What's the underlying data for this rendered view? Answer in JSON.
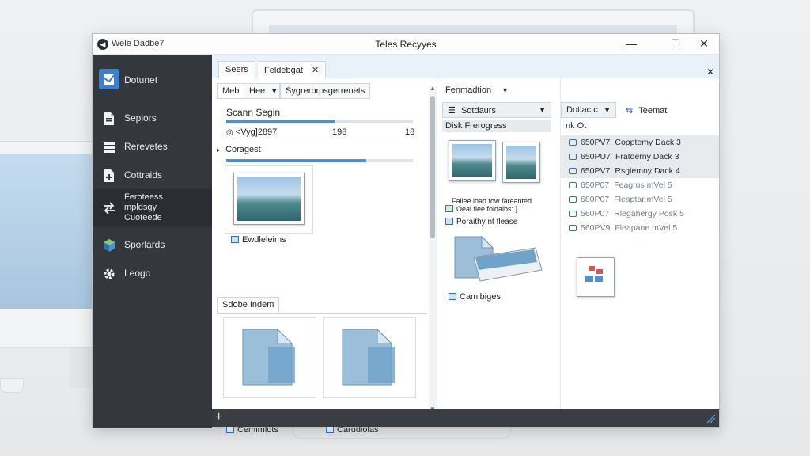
{
  "window": {
    "app_name": "Wele Dadbe7",
    "title": "Teles Recyyes",
    "controls": {
      "minimize": "—",
      "maximize": "☐",
      "close": "✕"
    }
  },
  "sidebar": {
    "items": [
      {
        "label": "Dotunet",
        "icon": "app-icon"
      },
      {
        "label": "Seplors",
        "icon": "document-icon"
      },
      {
        "label": "Rerevetes",
        "icon": "stack-icon"
      },
      {
        "label": "Cottraids",
        "icon": "doc-plus-icon"
      },
      {
        "label": "Feroteess\nmpldsgy\nCuoteede",
        "icon": "transfer-icon"
      },
      {
        "label": "Sporlards",
        "icon": "cube-icon"
      },
      {
        "label": "Leogo",
        "icon": "gear-icon"
      }
    ]
  },
  "tabs": {
    "items": [
      "Seers",
      "Feldebgat"
    ],
    "close": "✕",
    "panel_close": "✕"
  },
  "pane1": {
    "subtabs": [
      "Meb",
      "Hee",
      "Sygrerbrpsgerrenets"
    ],
    "scan_label": "Scann Segin",
    "scan_progress": 0.58,
    "row_label": "<Vyg]2897",
    "row_val1": "198",
    "row_val2": "18",
    "group_label": "Coragest",
    "group_progress": 0.75,
    "image_caption": "Ewdleleims",
    "section_tab": "Sdobe Indem",
    "cards": [
      {
        "caption": "Cemimlots"
      },
      {
        "caption": "Carudiolas"
      }
    ]
  },
  "pane2": {
    "dropdown_main": "Fenmadtion",
    "sort_dropdown": "Sotdaurs",
    "disk_header": "Disk Frerogress",
    "file_lines": [
      "Faliee load fow fareanted",
      "Oeal flee foidaibs: ]",
      "Poraithy nt flease"
    ],
    "caption": "Camibiges"
  },
  "pane3": {
    "dropdown": "Dotlac c",
    "filter_label": "Teemat",
    "header": "nk Ot",
    "rows": [
      {
        "id": "650PV7",
        "text": "Copptemy Dack 3",
        "shaded": true
      },
      {
        "id": "650PU7",
        "text": "Fratderny Dack 3",
        "shaded": true
      },
      {
        "id": "650PV7",
        "text": "Rsglemny Dack 4",
        "shaded": true
      },
      {
        "id": "650P07",
        "text": "Feagrus mVel 5",
        "shaded": false
      },
      {
        "id": "680P07",
        "text": "Fleaptar mVel 5",
        "shaded": false
      },
      {
        "id": "560P07",
        "text": "Rlegahergy Posk 5",
        "shaded": false
      },
      {
        "id": "560PV9",
        "text": "Fleapane mVel 5",
        "shaded": false
      }
    ]
  },
  "statusbar": {
    "add": "+"
  },
  "colors": {
    "sidebar_bg": "#34373c",
    "accent": "#4f8fd3",
    "tabstrip_bg": "#e9f2fa"
  }
}
